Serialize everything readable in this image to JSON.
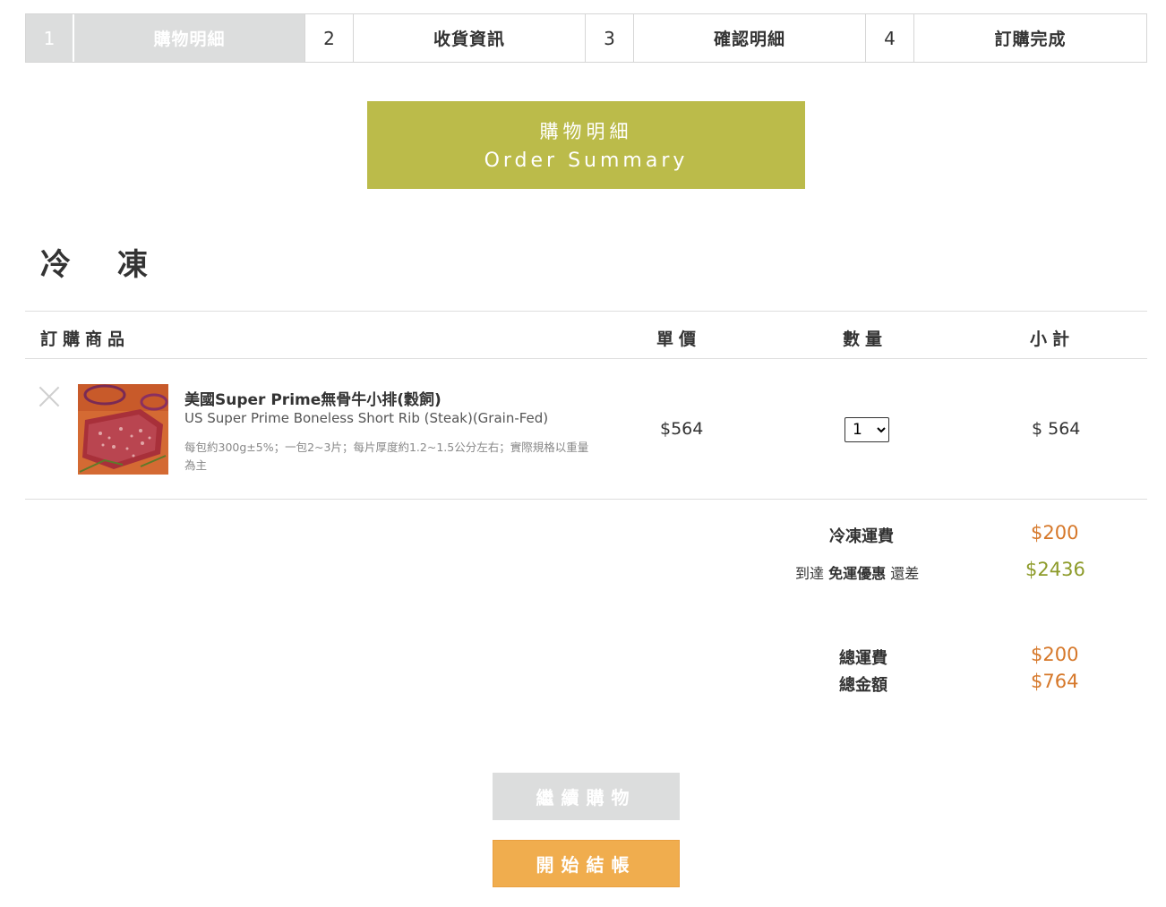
{
  "steps": [
    {
      "num": "1",
      "label": "購物明細",
      "active": true
    },
    {
      "num": "2",
      "label": "收貨資訊",
      "active": false
    },
    {
      "num": "3",
      "label": "確認明細",
      "active": false
    },
    {
      "num": "4",
      "label": "訂購完成",
      "active": false
    }
  ],
  "title": {
    "zh": "購物明細",
    "en": "Order Summary"
  },
  "section_title": "冷 凍",
  "table": {
    "headers": {
      "product": "訂購商品",
      "unit_price": "單價",
      "quantity": "數量",
      "subtotal": "小計"
    },
    "rows": [
      {
        "name": "美國Super Prime無骨牛小排(穀飼)",
        "name_en": "US Super Prime Boneless Short Rib (Steak)(Grain-Fed)",
        "spec": "每包約300g±5%；一包2~3片；每片厚度約1.2~1.5公分左右；實際規格以重量為主",
        "unit_price": "$564",
        "quantity": "1",
        "subtotal": "$ 564"
      }
    ]
  },
  "summary": {
    "shipping_label": "冷凍運費",
    "shipping_value": "$200",
    "free_prefix": "到達",
    "free_bold": "免運優惠",
    "free_suffix": "還差",
    "free_value": "$2436",
    "total_shipping_label": "總運費",
    "total_shipping_value": "$200",
    "total_label": "總金額",
    "total_value": "$764"
  },
  "buttons": {
    "continue": "繼續購物",
    "checkout": "開始結帳"
  },
  "colors": {
    "title_bg": "#bbbb4a",
    "orange": "#d6782a",
    "olive": "#8d9b2a",
    "checkout_bg": "#f0ad4e",
    "inactive": "#dcdddd"
  }
}
